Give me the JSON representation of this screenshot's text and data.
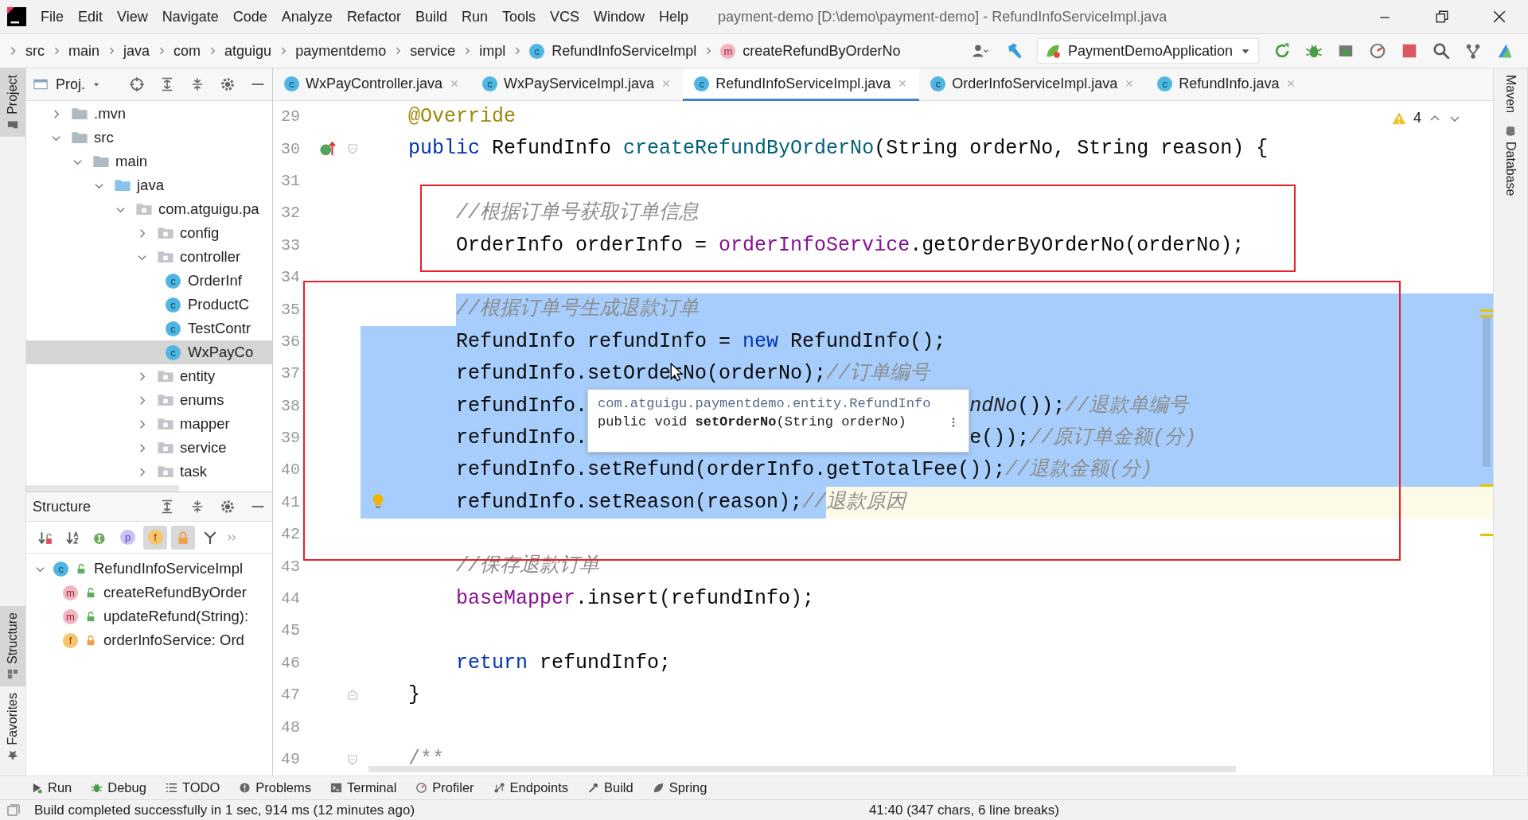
{
  "window": {
    "title": "payment-demo [D:\\demo\\payment-demo] - RefundInfoServiceImpl.java"
  },
  "menu": [
    "File",
    "Edit",
    "View",
    "Navigate",
    "Code",
    "Analyze",
    "Refactor",
    "Build",
    "Run",
    "Tools",
    "VCS",
    "Window",
    "Help"
  ],
  "breadcrumbs": [
    {
      "label": "src",
      "kind": "plain"
    },
    {
      "label": "main",
      "kind": "plain"
    },
    {
      "label": "java",
      "kind": "plain"
    },
    {
      "label": "com",
      "kind": "plain"
    },
    {
      "label": "atguigu",
      "kind": "plain"
    },
    {
      "label": "paymentdemo",
      "kind": "plain"
    },
    {
      "label": "service",
      "kind": "plain"
    },
    {
      "label": "impl",
      "kind": "plain"
    },
    {
      "label": "RefundInfoServiceImpl",
      "kind": "class",
      "glyph": "c"
    },
    {
      "label": "createRefundByOrderNo",
      "kind": "method",
      "glyph": "m"
    }
  ],
  "run_config": {
    "label": "PaymentDemoApplication"
  },
  "left_stripe": [
    {
      "label": "Project",
      "selected": true
    },
    {
      "label": "Structure",
      "selected": true
    },
    {
      "label": "Favorites",
      "selected": false
    }
  ],
  "right_stripe": [
    "Maven",
    "Database"
  ],
  "project_panel": {
    "title": "Proj.",
    "tree": [
      {
        "label": ".mvn",
        "kind": "folder",
        "expanded": false,
        "selected": false
      },
      {
        "label": "src",
        "kind": "folder",
        "expanded": true,
        "selected": false,
        "children": [
          {
            "label": "main",
            "kind": "folder",
            "expanded": true,
            "selected": false,
            "children": [
              {
                "label": "java",
                "kind": "source",
                "expanded": true,
                "selected": false,
                "children": [
                  {
                    "label": "com.atguigu.pa",
                    "kind": "package",
                    "expanded": true,
                    "selected": false,
                    "children": [
                      {
                        "label": "config",
                        "kind": "package",
                        "expanded": false,
                        "selected": false
                      },
                      {
                        "label": "controller",
                        "kind": "package",
                        "expanded": true,
                        "selected": false,
                        "children": [
                          {
                            "label": "OrderInf",
                            "kind": "class",
                            "glyph": "c",
                            "selected": false
                          },
                          {
                            "label": "ProductC",
                            "kind": "class",
                            "glyph": "c",
                            "selected": false
                          },
                          {
                            "label": "TestContr",
                            "kind": "class",
                            "glyph": "c",
                            "selected": false
                          },
                          {
                            "label": "WxPayCo",
                            "kind": "class",
                            "glyph": "c",
                            "selected": true
                          }
                        ]
                      },
                      {
                        "label": "entity",
                        "kind": "package",
                        "expanded": false,
                        "selected": false
                      },
                      {
                        "label": "enums",
                        "kind": "package",
                        "expanded": false,
                        "selected": false
                      },
                      {
                        "label": "mapper",
                        "kind": "package",
                        "expanded": false,
                        "selected": false
                      },
                      {
                        "label": "service",
                        "kind": "package",
                        "expanded": false,
                        "selected": false
                      },
                      {
                        "label": "task",
                        "kind": "package",
                        "expanded": false,
                        "selected": false
                      }
                    ]
                  }
                ]
              }
            ]
          }
        ]
      }
    ]
  },
  "structure_panel": {
    "title": "Structure",
    "toolbar": [
      {
        "kind": "sort-visibility",
        "on": false
      },
      {
        "kind": "sort-alpha",
        "on": false
      },
      {
        "kind": "inherited",
        "on": false
      },
      {
        "kind": "properties",
        "glyph": "p",
        "on": false
      },
      {
        "kind": "fields",
        "glyph": "f",
        "on": true
      },
      {
        "kind": "non-public",
        "on": true
      },
      {
        "kind": "lambdas",
        "on": false
      }
    ],
    "tree": [
      {
        "label": "RefundInfoServiceImpl",
        "kind": "class",
        "glyph": "c",
        "private": false,
        "expanded": true,
        "children": [
          {
            "label": "createRefundByOrder",
            "kind": "method",
            "glyph": "m",
            "private": false
          },
          {
            "label": "updateRefund(String):",
            "kind": "method",
            "glyph": "m",
            "private": false
          },
          {
            "label": "orderInfoService: Ord",
            "kind": "field",
            "glyph": "f",
            "private": true
          }
        ]
      }
    ]
  },
  "editor_tabs": [
    {
      "label": "WxPayController.java",
      "glyph": "c",
      "selected": false
    },
    {
      "label": "WxPayServiceImpl.java",
      "glyph": "c",
      "selected": false
    },
    {
      "label": "RefundInfoServiceImpl.java",
      "glyph": "c",
      "selected": true
    },
    {
      "label": "OrderInfoServiceImpl.java",
      "glyph": "c",
      "selected": false
    },
    {
      "label": "RefundInfo.java",
      "glyph": "c",
      "selected": false
    }
  ],
  "editor": {
    "warnings": "4",
    "tooltip": {
      "qualifier": "com.atguigu.paymentdemo.entity.RefundInfo",
      "signature": "public void **setOrderNo**(String orderNo)"
    },
    "lines": [
      {
        "number": "29",
        "tokens": [
          {
            "text": "    @Override",
            "kind": "annotation",
            "selected": false
          }
        ]
      },
      {
        "number": "30",
        "override_marker": true,
        "fold_marker": true,
        "tokens": [
          {
            "text": "    public ",
            "kind": "keyword",
            "selected": false
          },
          {
            "text": "RefundInfo ",
            "kind": "plain",
            "selected": false
          },
          {
            "text": "createRefundByOrderNo",
            "kind": "declaration",
            "selected": false
          },
          {
            "text": "(String orderNo, String reason) {",
            "kind": "plain",
            "selected": false
          }
        ]
      },
      {
        "number": "31"
      },
      {
        "number": "32",
        "box_start": true,
        "tokens": [
          {
            "text": "        //根据订单号获取订单信息",
            "kind": "comment",
            "selected": false
          }
        ]
      },
      {
        "number": "33",
        "box_end": true,
        "tokens": [
          {
            "text": "        OrderInfo orderInfo = ",
            "kind": "plain",
            "selected": false
          },
          {
            "text": "orderInfoService",
            "kind": "field",
            "selected": false
          },
          {
            "text": ".getOrderByOrderNo(orderNo);",
            "kind": "plain",
            "selected": false
          }
        ]
      },
      {
        "number": "34"
      },
      {
        "number": "35",
        "box_start": true,
        "indent_selected": false,
        "selected_to_end": true,
        "tokens": [
          {
            "text": "        //根据订单号生成退款订单",
            "kind": "comment",
            "selected": true
          }
        ]
      },
      {
        "number": "36",
        "indent_selected": true,
        "selected_to_end": true,
        "tokens": [
          {
            "text": "        RefundInfo refundInfo = ",
            "kind": "plain",
            "selected": true
          },
          {
            "text": "new ",
            "kind": "keyword",
            "selected": true
          },
          {
            "text": "RefundInfo();",
            "kind": "plain",
            "selected": true
          }
        ]
      },
      {
        "number": "37",
        "indent_selected": true,
        "selected_to_end": true,
        "tokens": [
          {
            "text": "        refundInfo.setOrde",
            "kind": "plain",
            "selected": true
          },
          {
            "text": "rNo(orderNo);",
            "kind": "plain",
            "selected": true,
            "pointer": true
          },
          {
            "text": "//订单编号",
            "kind": "comment",
            "selected": true
          }
        ]
      },
      {
        "number": "38",
        "indent_selected": true,
        "selected_to_end": true,
        "tokens": [
          {
            "text": "        refundInfo.",
            "kind": "plain",
            "selected": true
          },
          {
            "text": "ndNo",
            "kind": "static",
            "selected": true,
            "after_tooltip": true
          },
          {
            "text": "());",
            "kind": "plain",
            "selected": true
          },
          {
            "text": "//退款单编号",
            "kind": "comment",
            "selected": true
          }
        ]
      },
      {
        "number": "39",
        "indent_selected": true,
        "selected_to_end": true,
        "tokens": [
          {
            "text": "        refundInfo.",
            "kind": "plain",
            "selected": true
          },
          {
            "text": "e());",
            "kind": "plain",
            "selected": true,
            "after_tooltip": true
          },
          {
            "text": "//原订单金额(分)",
            "kind": "comment",
            "selected": true
          }
        ]
      },
      {
        "number": "40",
        "indent_selected": true,
        "selected_to_end": true,
        "tokens": [
          {
            "text": "        refundInfo.setRefund(orderInfo.getTotalFee());",
            "kind": "plain",
            "selected": true
          },
          {
            "text": "//退款金额(分)",
            "kind": "comment",
            "selected": true
          }
        ]
      },
      {
        "number": "41",
        "indent_selected": true,
        "caret_line": true,
        "bulb": true,
        "tokens": [
          {
            "text": "        refundInfo.setReason(reason);",
            "kind": "plain",
            "selected": true
          },
          {
            "text": "//",
            "kind": "comment",
            "selected": true
          },
          {
            "text": "退款原因",
            "kind": "comment",
            "selected": false
          }
        ]
      },
      {
        "number": "42",
        "box_end": true
      },
      {
        "number": "43",
        "tokens": [
          {
            "text": "        //保存退款订单",
            "kind": "comment",
            "selected": false
          }
        ]
      },
      {
        "number": "44",
        "tokens": [
          {
            "text": "        baseMapper",
            "kind": "field",
            "selected": false
          },
          {
            "text": ".insert(refundInfo);",
            "kind": "plain",
            "selected": false
          }
        ]
      },
      {
        "number": "45"
      },
      {
        "number": "46",
        "tokens": [
          {
            "text": "        return ",
            "kind": "keyword",
            "selected": false
          },
          {
            "text": "refundInfo;",
            "kind": "plain",
            "selected": false
          }
        ]
      },
      {
        "number": "47",
        "fold_end_marker": true,
        "tokens": [
          {
            "text": "    }",
            "kind": "plain",
            "selected": false
          }
        ]
      },
      {
        "number": "48"
      },
      {
        "number": "49",
        "fold_marker": true,
        "tokens": [
          {
            "text": "    /**",
            "kind": "doc",
            "selected": false
          }
        ]
      }
    ]
  },
  "tool_windows": [
    {
      "label": "Run",
      "kind": "run"
    },
    {
      "label": "Debug",
      "kind": "debug"
    },
    {
      "label": "TODO",
      "kind": "todo"
    },
    {
      "label": "Problems",
      "kind": "problems"
    },
    {
      "label": "Terminal",
      "kind": "terminal"
    },
    {
      "label": "Profiler",
      "kind": "profiler"
    },
    {
      "label": "Endpoints",
      "kind": "endpoints"
    },
    {
      "label": "Build",
      "kind": "build"
    },
    {
      "label": "Spring",
      "kind": "spring"
    }
  ],
  "status_bar": {
    "message": "Build completed successfully in 1 sec, 914 ms (12 minutes ago)",
    "position": "41:40 (347 chars, 6 line breaks)"
  }
}
